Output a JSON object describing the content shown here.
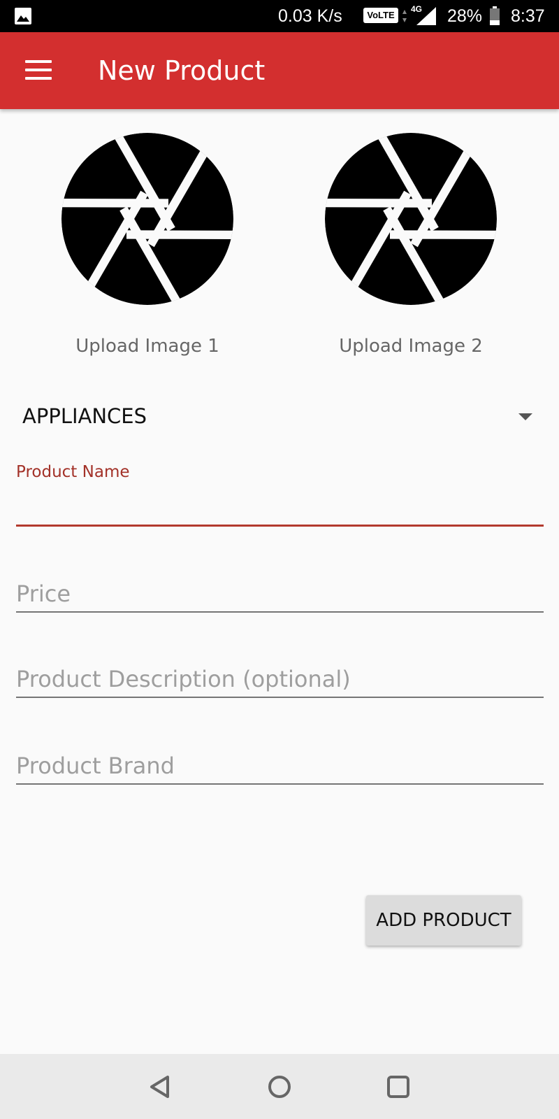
{
  "status_bar": {
    "net_speed": "0.03 K/s",
    "volte": "VoLTE",
    "network_type": "4G",
    "battery": "28%",
    "time": "8:37",
    "icons": [
      "gallery-icon",
      "signal-icon",
      "battery-icon"
    ]
  },
  "app_bar": {
    "title": "New Product",
    "background": "#d32f2f",
    "menu_icon": "hamburger-menu-icon"
  },
  "images": [
    {
      "label": "Upload Image 1",
      "icon": "camera-aperture-icon"
    },
    {
      "label": "Upload Image 2",
      "icon": "camera-aperture-icon"
    }
  ],
  "category": {
    "selected": "APPLIANCES"
  },
  "form": {
    "product_name": {
      "label": "Product Name",
      "value": ""
    },
    "price": {
      "placeholder": "Price",
      "value": ""
    },
    "description": {
      "placeholder": "Product Description (optional)",
      "value": ""
    },
    "brand": {
      "placeholder": "Product Brand",
      "value": ""
    },
    "accent_color": "#b33a2e"
  },
  "actions": {
    "add_product": "ADD PRODUCT"
  },
  "nav_bar": {
    "icons": [
      "back-icon",
      "home-icon",
      "recents-icon"
    ]
  }
}
